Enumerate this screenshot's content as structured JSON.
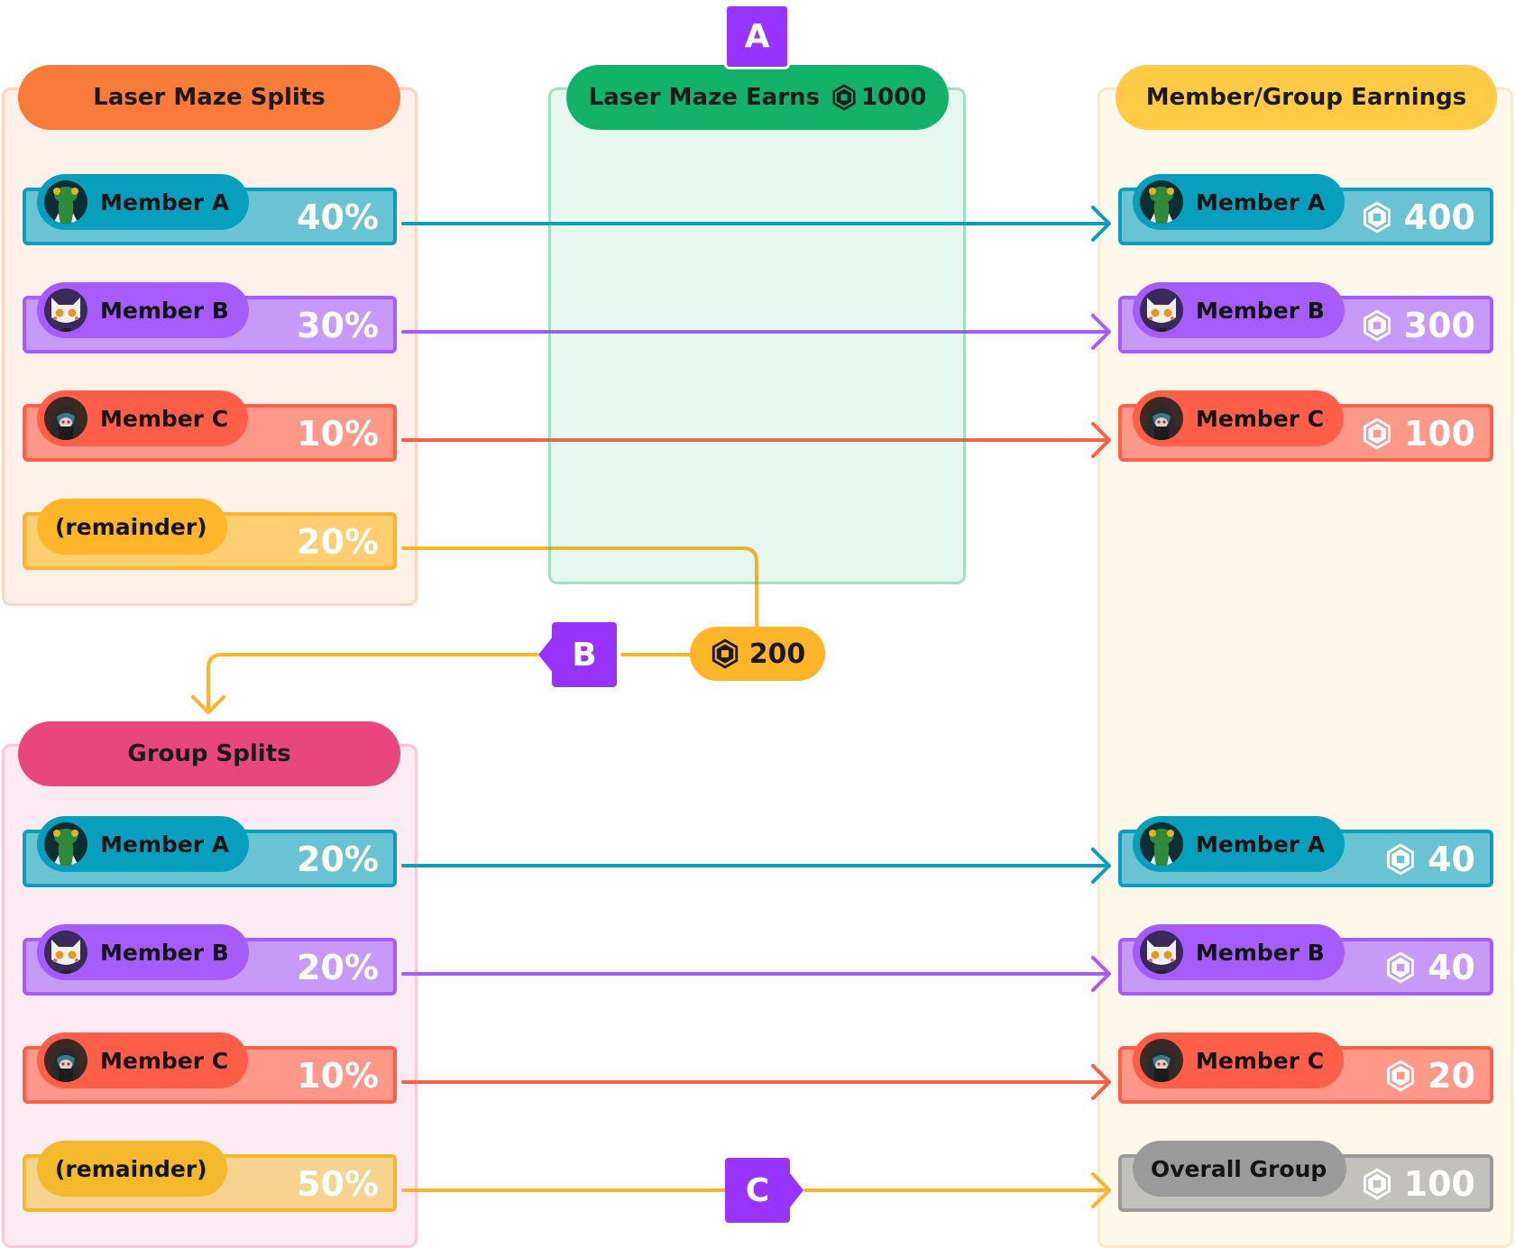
{
  "colors": {
    "teal": "#069fbe",
    "teal_light": "#6ac3d3",
    "purple": "#a55cfb",
    "purple_light": "#c89af7",
    "red": "#ff5e49",
    "red_light": "#ff9888",
    "yellow": "#ffb527",
    "yellow_light": "#ffcd72",
    "gold_group": "#f3b92b",
    "gold_group_light": "#f6d38e",
    "gray": "#9a9a9a",
    "gray_light": "#c2c1bc",
    "marker": "#9933ff",
    "splits_header": "#f87b3a",
    "earns_header": "#12b26a",
    "earnings_header": "#ffca44",
    "group_header": "#e8477d"
  },
  "markers": {
    "a": "A",
    "b": "B",
    "c": "C"
  },
  "laser_splits": {
    "title": "Laser Maze Splits",
    "rows": [
      {
        "name": "Member A",
        "value": "40%",
        "avatar": "lizard-avatar"
      },
      {
        "name": "Member B",
        "value": "30%",
        "avatar": "cat-avatar"
      },
      {
        "name": "Member C",
        "value": "10%",
        "avatar": "hooded-avatar"
      },
      {
        "name": "(remainder)",
        "value": "20%",
        "avatar": null
      }
    ]
  },
  "earns": {
    "title": "Laser Maze Earns",
    "amount": "1000",
    "currency_icon": "robux-icon"
  },
  "remainder_amount": "200",
  "earnings": {
    "title": "Member/Group Earnings",
    "rows": [
      {
        "name": "Member A",
        "value": "400"
      },
      {
        "name": "Member B",
        "value": "300"
      },
      {
        "name": "Member C",
        "value": "100"
      },
      {
        "name": "Member A",
        "value": "40"
      },
      {
        "name": "Member B",
        "value": "40"
      },
      {
        "name": "Member C",
        "value": "20"
      },
      {
        "name": "Overall Group",
        "value": "100"
      }
    ]
  },
  "group_splits": {
    "title": "Group Splits",
    "rows": [
      {
        "name": "Member A",
        "value": "20%"
      },
      {
        "name": "Member B",
        "value": "20%"
      },
      {
        "name": "Member C",
        "value": "10%"
      },
      {
        "name": "(remainder)",
        "value": "50%"
      }
    ]
  }
}
